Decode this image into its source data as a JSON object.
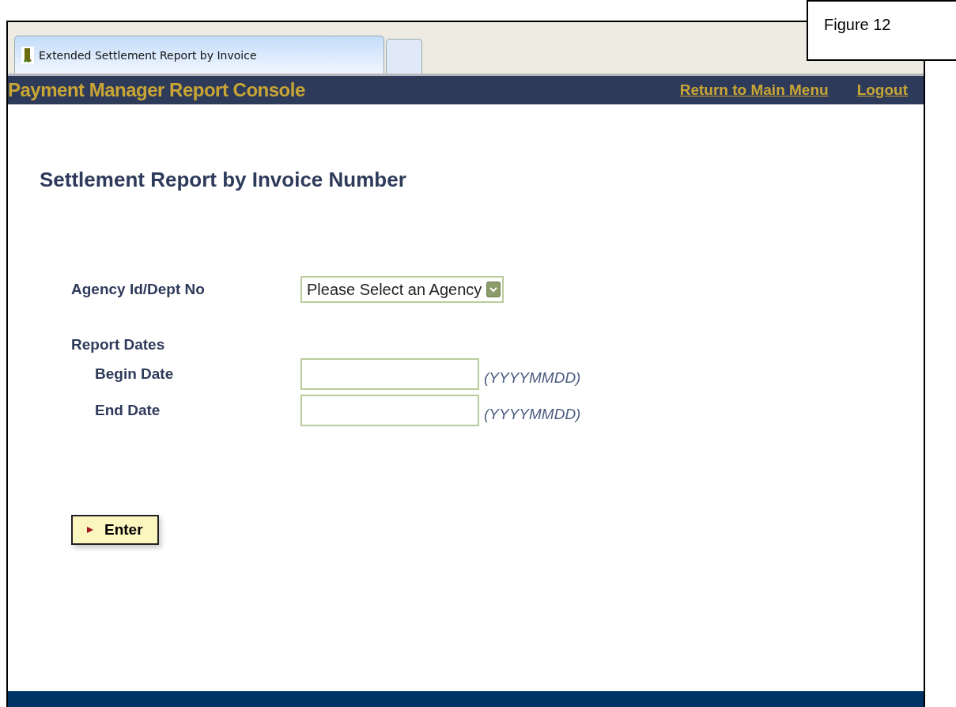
{
  "figure_label": "Figure 12",
  "tabs": [
    {
      "title": "Extended Settlement Report by Invoice",
      "selected": true
    },
    {
      "selected": false
    }
  ],
  "header": {
    "title": "Payment Manager Report Console",
    "links": [
      "Return to Main Menu",
      "Logout"
    ]
  },
  "page_title": "Settlement Report by Invoice Number",
  "agency": {
    "label": "Agency Id/Dept No",
    "select_value": "Please Select an Agency"
  },
  "report_dates": {
    "label": "Report Dates",
    "fields": [
      {
        "label": "Begin Date",
        "hint": "(YYYYMMDD)"
      },
      {
        "label": "End Date",
        "hint": "(YYYYMMDD)"
      }
    ]
  },
  "enter_button": "Enter"
}
